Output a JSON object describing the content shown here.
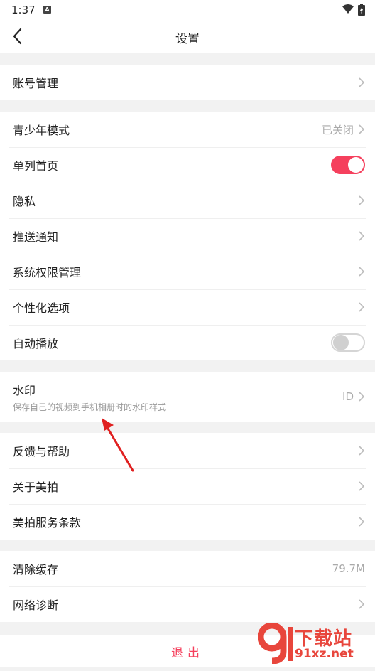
{
  "status_bar": {
    "time": "1:37",
    "notif_badge": "A"
  },
  "header": {
    "title": "设置"
  },
  "groups": {
    "account": [
      {
        "label": "账号管理"
      }
    ],
    "general": [
      {
        "label": "青少年模式",
        "value": "已关闭"
      },
      {
        "label": "单列首页",
        "toggle": "on"
      },
      {
        "label": "隐私"
      },
      {
        "label": "推送通知"
      },
      {
        "label": "系统权限管理"
      },
      {
        "label": "个性化选项"
      },
      {
        "label": "自动播放",
        "toggle": "off"
      }
    ],
    "watermark": {
      "label": "水印",
      "sub": "保存自己的视频到手机相册时的水印样式",
      "value": "ID"
    },
    "help": [
      {
        "label": "反馈与帮助"
      },
      {
        "label": "关于美拍"
      },
      {
        "label": "美拍服务条款"
      }
    ],
    "tools": [
      {
        "label": "清除缓存",
        "value": "79.7M"
      },
      {
        "label": "网络诊断"
      }
    ]
  },
  "logout_label": "退出",
  "site_watermark": {
    "top": "下载站",
    "bottom": "91xz.net"
  },
  "colors": {
    "accent": "#f5405d",
    "watermark": "#e8463c"
  }
}
